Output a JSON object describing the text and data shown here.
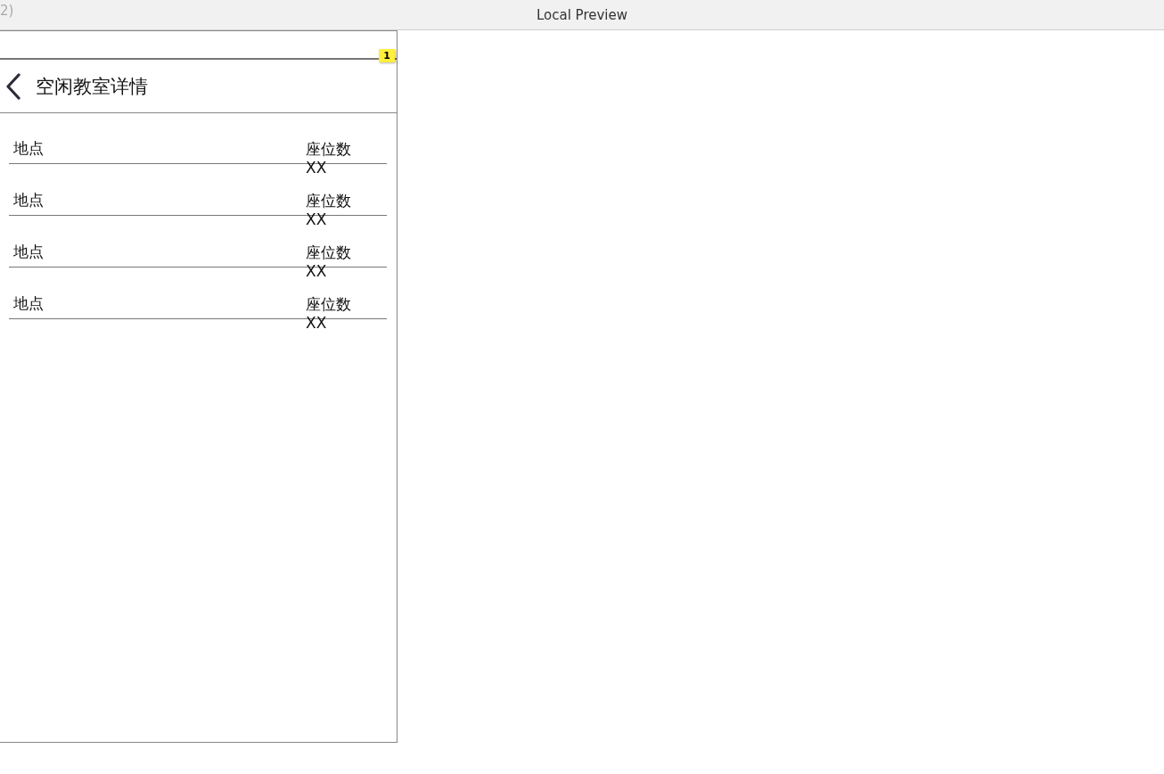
{
  "window": {
    "title": "Local Preview",
    "title_fragment": "2)"
  },
  "badge": "1",
  "header": {
    "title": "空闲教室详情"
  },
  "rooms": [
    {
      "location": "地点",
      "seat_label": "座位数",
      "seat_value": "XX"
    },
    {
      "location": "地点",
      "seat_label": "座位数",
      "seat_value": "XX"
    },
    {
      "location": "地点",
      "seat_label": "座位数",
      "seat_value": "XX"
    },
    {
      "location": "地点",
      "seat_label": "座位数",
      "seat_value": "XX"
    }
  ]
}
